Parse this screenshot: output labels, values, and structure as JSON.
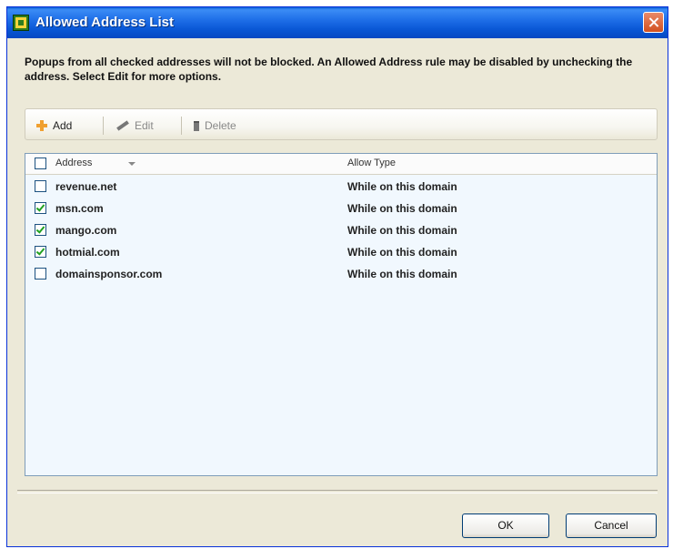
{
  "window": {
    "title": "Allowed Address List"
  },
  "description": "Popups from all checked addresses will not be blocked. An Allowed Address rule may be disabled by unchecking the address. Select Edit for more options.",
  "toolbar": {
    "add_label": "Add",
    "edit_label": "Edit",
    "delete_label": "Delete"
  },
  "list": {
    "columns": {
      "address": "Address",
      "allow_type": "Allow Type"
    },
    "rows": [
      {
        "address": "revenue.net",
        "allow_type": "While on this domain",
        "checked": false
      },
      {
        "address": "msn.com",
        "allow_type": "While on this domain",
        "checked": true
      },
      {
        "address": "mango.com",
        "allow_type": "While on this domain",
        "checked": true
      },
      {
        "address": "hotmial.com",
        "allow_type": "While on this domain",
        "checked": true
      },
      {
        "address": "domainsponsor.com",
        "allow_type": "While on this domain",
        "checked": false
      }
    ]
  },
  "buttons": {
    "ok": "OK",
    "cancel": "Cancel"
  },
  "icons": {
    "app": "app-icon",
    "close": "close-icon",
    "add": "plus-icon",
    "edit": "pencil-icon",
    "delete": "trash-icon",
    "sort": "sort-arrow-icon"
  },
  "colors": {
    "titlebar": "#0a58d6",
    "list_background": "#f1f8fe",
    "dialog_background": "#ece9d8"
  }
}
